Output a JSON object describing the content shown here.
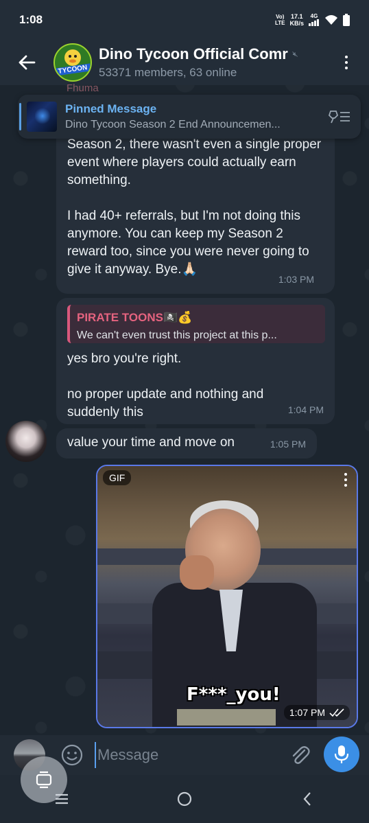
{
  "status_bar": {
    "time": "1:08",
    "network_line1": "Vo)",
    "network_line2": "LTE",
    "speed_value": "17.1",
    "speed_unit": "KB/s",
    "signal_type": "4G"
  },
  "header": {
    "title": "Dino Tycoon Official Comr",
    "subtitle": "53371 members, 63 online",
    "avatar_text": "TYCOON",
    "muted_icon": "mute-icon"
  },
  "faded_sender": "Fhuma",
  "pinned": {
    "title": "Pinned Message",
    "text": "Dino Tycoon Season 2 End Announcemen..."
  },
  "messages": [
    {
      "lines": [
        "Season 2, there wasn't even a single proper event where players could actually earn something.",
        "I had 40+ referrals, but I'm not doing this anymore. You can keep my Season 2 reward too, since you were never going to give it anyway. Bye.🙏🏻"
      ],
      "time": "1:03 PM"
    },
    {
      "reply_name": "PIRATE TOONS🏴‍☠️💰",
      "reply_text": "We can't even trust this project at this p...",
      "lines": [
        "yes bro you're right.",
        "no proper update and nothing and suddenly this"
      ],
      "time": "1:04 PM"
    },
    {
      "text": "value your time and move on",
      "time": "1:05 PM"
    }
  ],
  "gif_message": {
    "badge": "GIF",
    "caption": "F***_you!",
    "time": "1:07 PM"
  },
  "input": {
    "placeholder": "Message"
  },
  "colors": {
    "accent": "#3b8fe6",
    "reply_accent": "#e5637f",
    "bubble": "#262f3a",
    "header": "#232d38"
  }
}
